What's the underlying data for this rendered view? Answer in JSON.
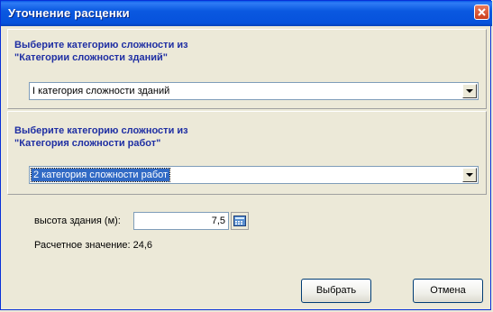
{
  "window": {
    "title": "Уточнение расценки"
  },
  "building_category": {
    "heading": "Выберите категорию сложности из\n\"Категории сложности зданий\"",
    "selected": "I категория сложности зданий"
  },
  "work_category": {
    "heading": "Выберите категорию сложности из\n\"Категория сложности работ\"",
    "selected": "2 категория сложности работ"
  },
  "height": {
    "label": "высота здания (м):",
    "value": "7,5"
  },
  "result": {
    "text": "Расчетное значение: 24,6"
  },
  "buttons": {
    "select": "Выбрать",
    "cancel": "Отмена"
  },
  "colors": {
    "titlebar": "#0a58e0",
    "heading": "#1f2fa3",
    "selection": "#316ac5"
  },
  "icons": {
    "close": "close-icon",
    "dropdown": "chevron-down-icon",
    "calculator": "calculator-icon"
  }
}
